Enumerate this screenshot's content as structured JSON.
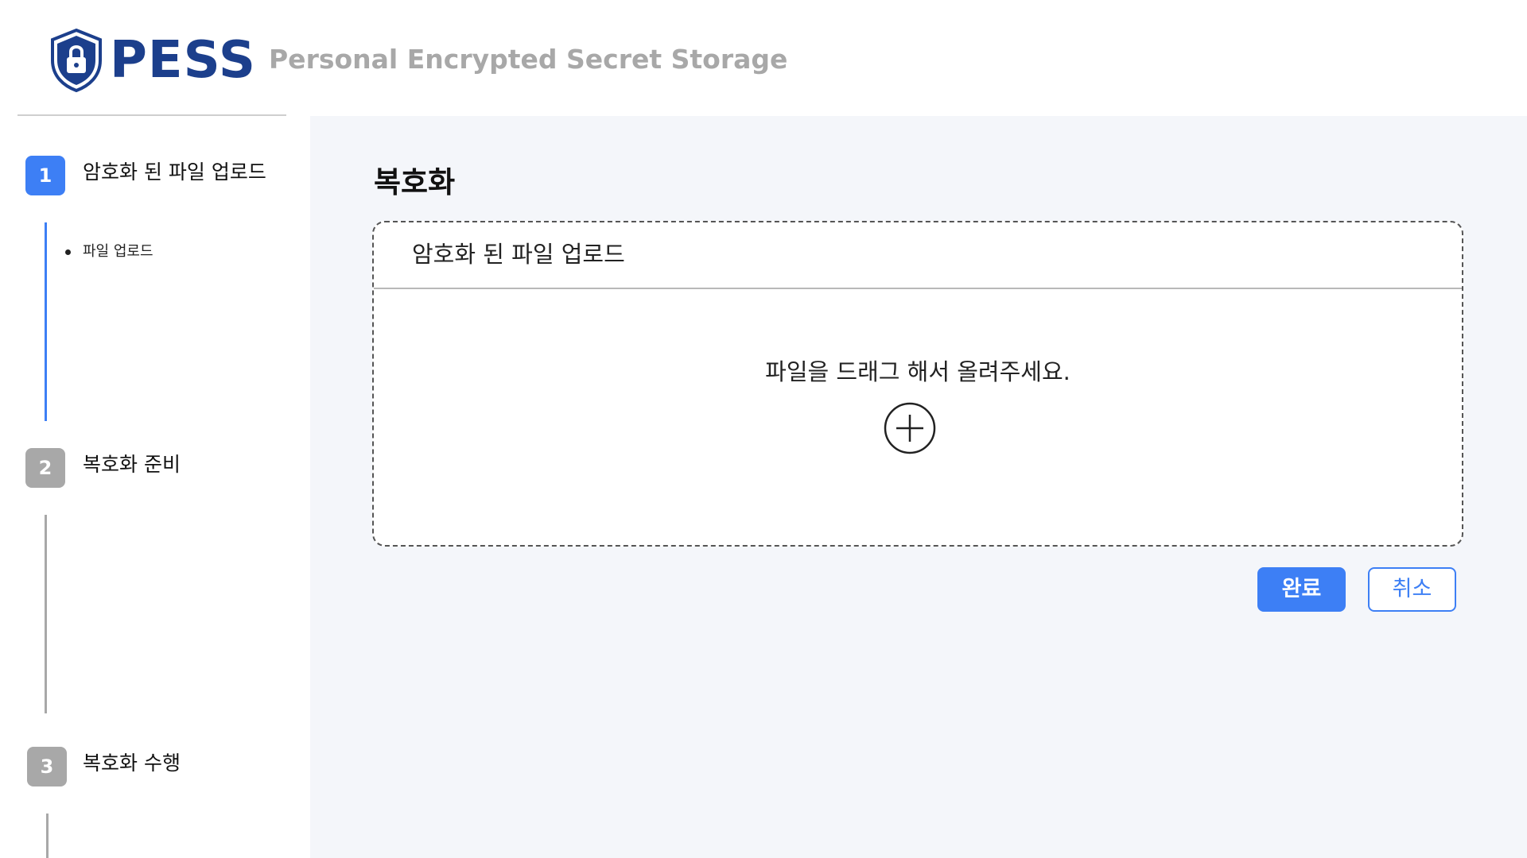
{
  "header": {
    "logo_text": "PESS",
    "tagline": "Personal Encrypted Secret Storage",
    "logo_icon": "shield-lock-icon"
  },
  "sidebar": {
    "steps": [
      {
        "number": "1",
        "label": "암호화 된 파일 업로드",
        "state": "active",
        "sub_items": [
          "파일 업로드"
        ]
      },
      {
        "number": "2",
        "label": "복호화 준비",
        "state": "inactive",
        "sub_items": []
      },
      {
        "number": "3",
        "label": "복호화 수행",
        "state": "inactive",
        "sub_items": []
      }
    ]
  },
  "main": {
    "title": "복호화",
    "upload_panel": {
      "title": "암호화 된 파일 업로드",
      "hint": "파일을 드래그 해서 올려주세요.",
      "add_icon": "plus-circle-icon"
    },
    "buttons": {
      "confirm_label": "완료",
      "cancel_label": "취소"
    }
  },
  "colors": {
    "brand": "#1c3f8c",
    "accent": "#3d7ff5",
    "inactive": "#a8a8a8",
    "main_background": "#f4f6fa"
  }
}
